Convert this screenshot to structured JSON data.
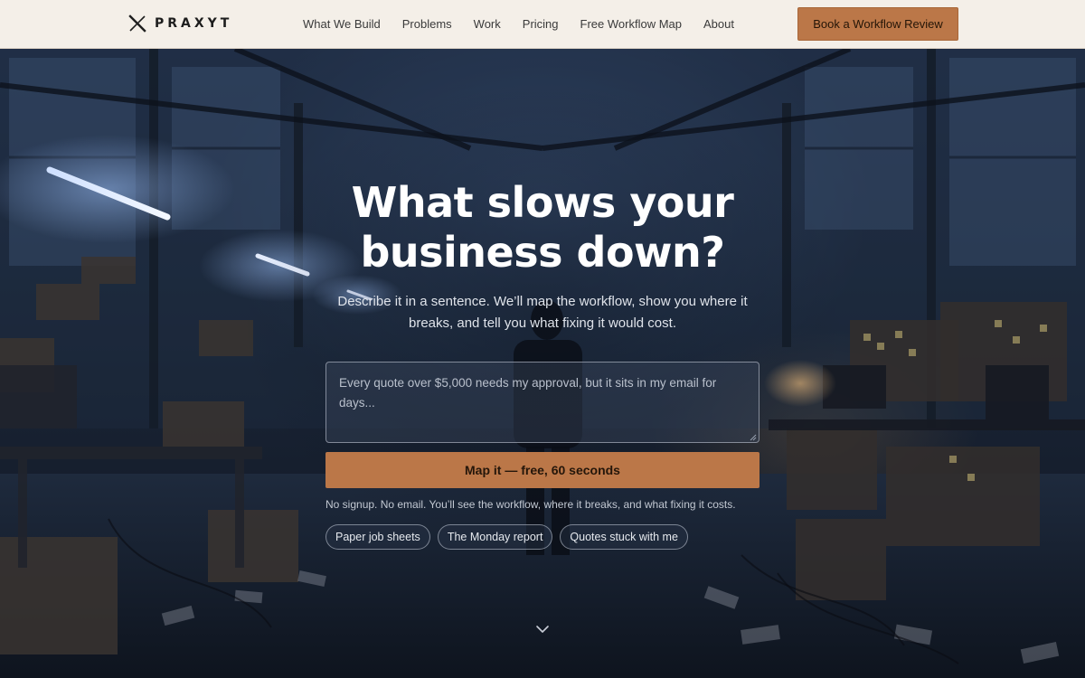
{
  "header": {
    "brand_name": "PRAXYT",
    "brand_icon": "x-logo-icon",
    "nav": [
      {
        "label": "What We Build"
      },
      {
        "label": "Problems"
      },
      {
        "label": "Work"
      },
      {
        "label": "Pricing"
      },
      {
        "label": "Free Workflow Map"
      },
      {
        "label": "About"
      }
    ],
    "cta_label": "Book a Workflow Review"
  },
  "hero": {
    "title_line1": "What slows your",
    "title_line2": "business down?",
    "subtitle": "Describe it in a sentence. We’ll map the workflow, show you where it breaks, and tell you what fixing it would cost.",
    "input_placeholder": "Every quote over $5,000 needs my approval, but it sits in my email for days...",
    "submit_label": "Map it — free, 60 seconds",
    "fine_print": "No signup. No email. You’ll see the workflow, where it breaks, and what fixing it costs.",
    "examples": [
      {
        "label": "Paper job sheets"
      },
      {
        "label": "The Monday report"
      },
      {
        "label": "Quotes stuck with me"
      }
    ],
    "scroll_icon": "chevron-down-icon"
  },
  "colors": {
    "accent": "#bb7748",
    "header_bg": "#f4efe8",
    "hero_bg": "#1b2638"
  }
}
